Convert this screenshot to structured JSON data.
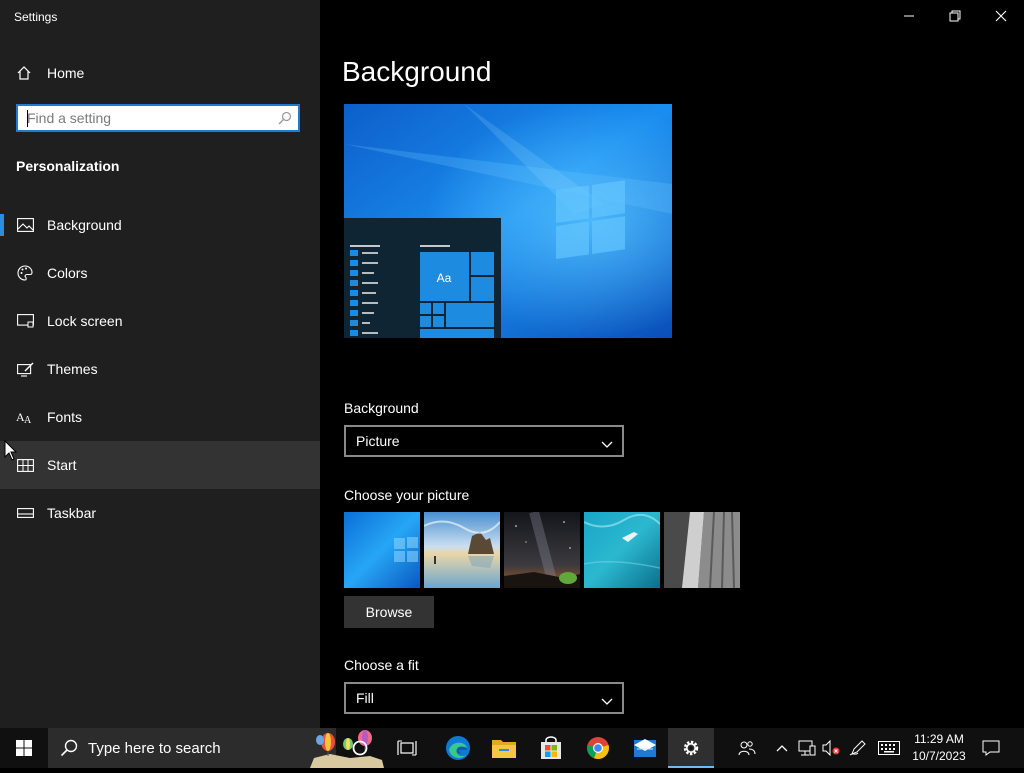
{
  "window": {
    "title": "Settings",
    "controls": [
      "minimize",
      "restore",
      "close"
    ]
  },
  "sidebar": {
    "home_label": "Home",
    "search_placeholder": "Find a setting",
    "section_title": "Personalization",
    "items": [
      {
        "label": "Background",
        "icon": "picture-icon",
        "selected": true
      },
      {
        "label": "Colors",
        "icon": "palette-icon"
      },
      {
        "label": "Lock screen",
        "icon": "lock-screen-icon"
      },
      {
        "label": "Themes",
        "icon": "themes-icon"
      },
      {
        "label": "Fonts",
        "icon": "fonts-icon"
      },
      {
        "label": "Start",
        "icon": "start-layout-icon",
        "hover": true
      },
      {
        "label": "Taskbar",
        "icon": "taskbar-icon"
      }
    ]
  },
  "main": {
    "title": "Background",
    "preview_tile_text": "Aa",
    "background_label": "Background",
    "background_value": "Picture",
    "choose_picture_label": "Choose your picture",
    "pictures": [
      "windows-blue",
      "beach-rocks",
      "night-sky",
      "underwater-swimmer",
      "rock-cliff"
    ],
    "browse_label": "Browse",
    "fit_label": "Choose a fit",
    "fit_value": "Fill"
  },
  "taskbar": {
    "search_text": "Type here to search",
    "apps": [
      "cortana",
      "task-view",
      "edge",
      "file-explorer",
      "store",
      "chrome",
      "mail",
      "settings"
    ],
    "active_app": "settings",
    "time": "11:29 AM",
    "date": "10/7/2023"
  },
  "colors": {
    "accent": "#1f7ad3",
    "sidebar_bg": "#1f1f1f",
    "main_bg": "#000000",
    "taskbar_bg": "#101010"
  }
}
